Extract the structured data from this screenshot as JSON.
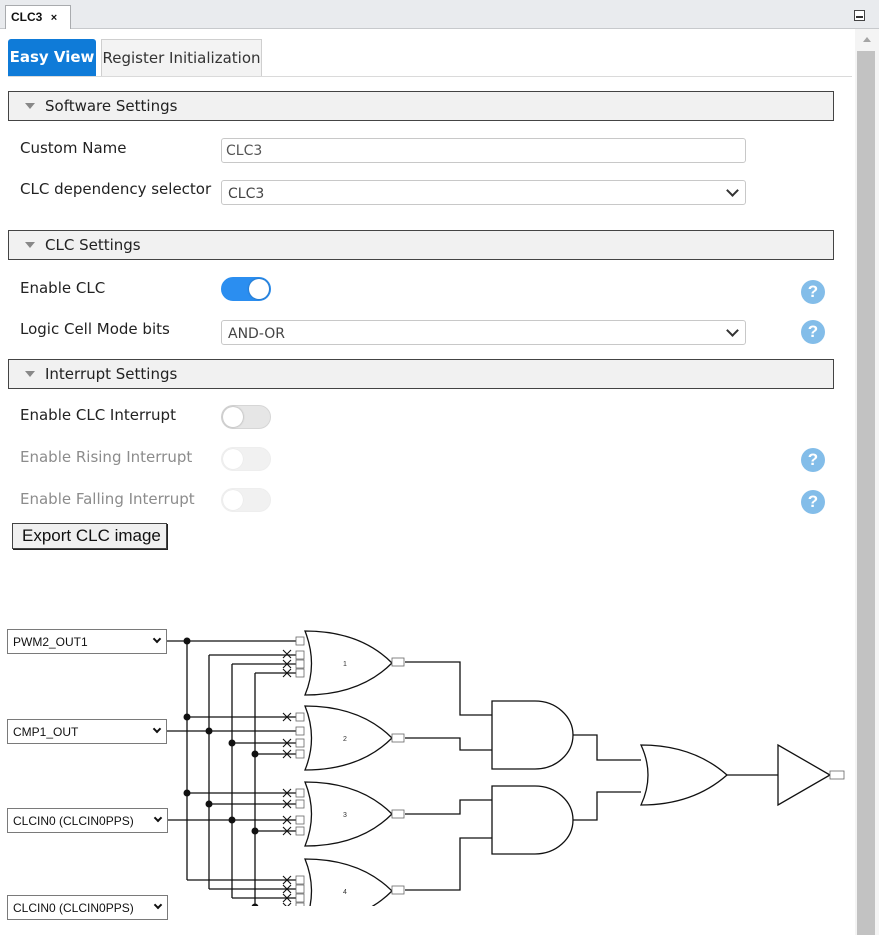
{
  "editor_tab": {
    "title": "CLC3",
    "close": "×"
  },
  "tabs": {
    "easy_view": "Easy View",
    "register_init": "Register Initialization"
  },
  "software_settings": {
    "title": "Software Settings",
    "custom_name_label": "Custom Name",
    "custom_name_value": "CLC3",
    "dependency_label": "CLC dependency selector",
    "dependency_value": "CLC3"
  },
  "clc_settings": {
    "title": "CLC Settings",
    "enable_label": "Enable CLC",
    "enable_on": true,
    "mode_label": "Logic Cell Mode bits",
    "mode_value": "AND-OR"
  },
  "interrupt_settings": {
    "title": "Interrupt Settings",
    "enable_int_label": "Enable CLC Interrupt",
    "rising_label": "Enable Rising Interrupt",
    "falling_label": "Enable Falling Interrupt"
  },
  "help_glyph": "?",
  "export_button": "Export CLC image",
  "diagram": {
    "inputs": [
      "PWM2_OUT1",
      "CMP1_OUT",
      "CLCIN0 (CLCIN0PPS)",
      "CLCIN0 (CLCIN0PPS)"
    ],
    "gate_numbers": [
      "1",
      "2",
      "3",
      "4"
    ]
  },
  "colors": {
    "accent": "#0f7bd8",
    "toggle_on": "#2b8ef0",
    "help": "#83bde9"
  }
}
